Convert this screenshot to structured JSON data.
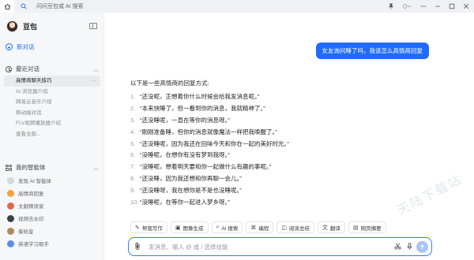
{
  "titlebar": {
    "search_placeholder": "问问豆包或 AI 搜索"
  },
  "sidebar": {
    "brand_name": "豆包",
    "new_chat_label": "新对话",
    "recent_header": "最近对话",
    "recent_items": [
      "高情商聊天技巧",
      "AI 浏览器介绍",
      "网易云音乐介绍",
      "移动端对话",
      "FLV视频播放器介绍",
      "查看全部..."
    ],
    "agents_header": "我的智能体",
    "agents": [
      {
        "label": "发现 AI 智能体",
        "color": "#c9ccd2"
      },
      {
        "label": "高情商回复",
        "color": "#f3a23a"
      },
      {
        "label": "文献精读家",
        "color": "#e0684b"
      },
      {
        "label": "视频去水印",
        "color": "#3b3f4a"
      },
      {
        "label": "秦始皇",
        "color": "#b08a5a"
      },
      {
        "label": "英语学习助手",
        "color": "#5a8de8"
      }
    ]
  },
  "chat": {
    "user_message": "女友询问睡了吗，我该怎么高情商回复",
    "answer_intro": "以下是一些高情商的回复方式:",
    "answers": [
      "“还没呢，正想着你什么时候会给我发消息呢。”",
      "“本来快睡了，但一看到你的消息，我就精神了。”",
      "“还没睡呢，一直在等你的消息呀。”",
      "“刚刚准备睡，但你的消息就像魔法一样把我唤醒了。”",
      "“还没睡呢，因为我还在回味今天和你在一起的美好时光。”",
      "“没睡呢，在想你有没有梦到我呀。”",
      "“没睡呢，想着明天要和你一起做什么有趣的事呢。”",
      "“还没睡，因为我还想和你再聊一会儿。”",
      "“还没睡呀，我在想你是不是也没睡呢。”",
      "“没睡呢，在等你一起进入梦乡呀。”"
    ]
  },
  "tools": [
    {
      "icon": "✎",
      "label": "帮我写作"
    },
    {
      "icon": "▣",
      "label": "图像生成"
    },
    {
      "icon": "⌕",
      "label": "AI 搜索"
    },
    {
      "icon": "⌘",
      "label": "编程"
    },
    {
      "icon": "◫",
      "label": "阅读总结"
    },
    {
      "icon": "文",
      "label": "翻译"
    },
    {
      "icon": "▤",
      "label": "网页摘要"
    }
  ],
  "input": {
    "placeholder": "发消息、输入 @ 或 / 选择技能"
  },
  "watermark": "天陆下载站"
}
